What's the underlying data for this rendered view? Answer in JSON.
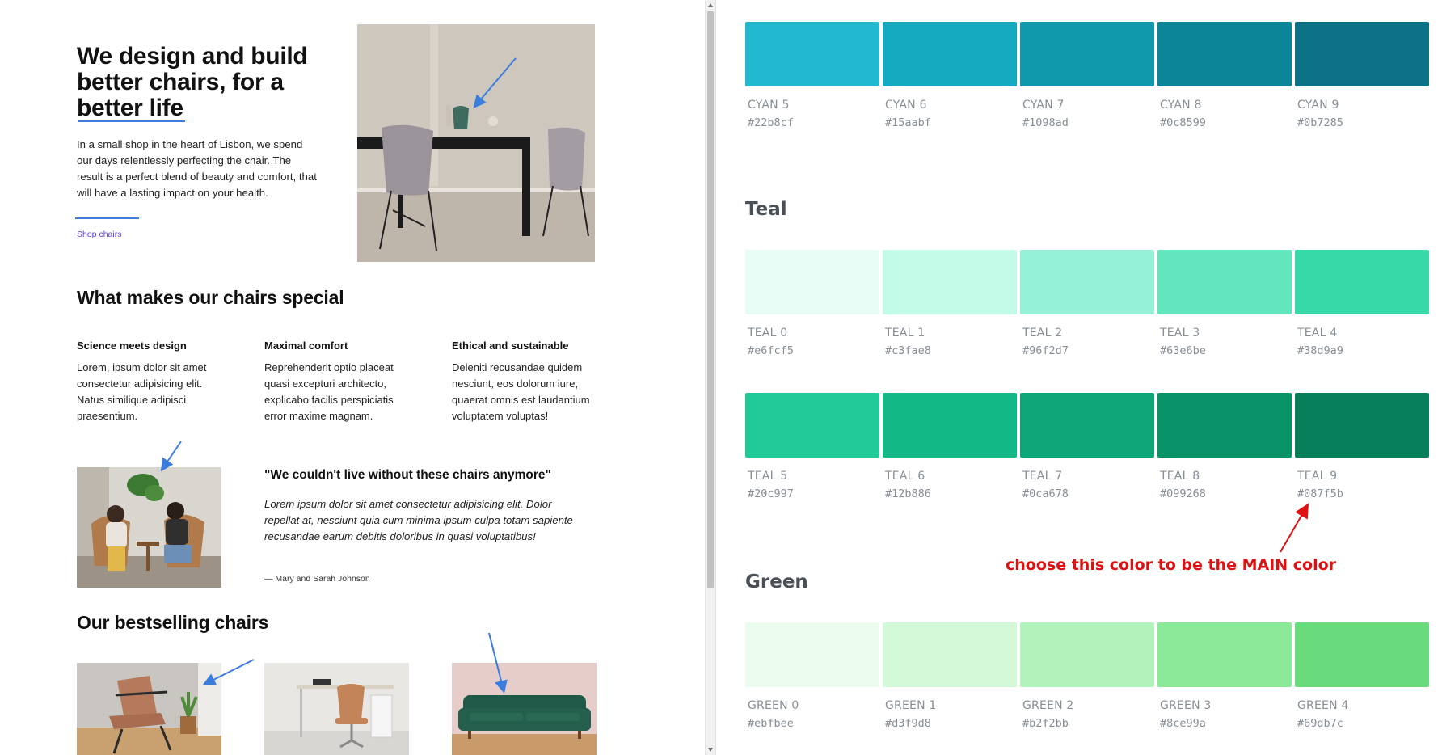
{
  "landing": {
    "hero": {
      "title": "We design and build better chairs, for a better life",
      "description": "In a small shop in the heart of Lisbon, we spend our days relentlessly perfecting the chair. The result is a perfect blend of beauty and comfort, that will have a lasting impact on your health.",
      "link": "Shop chairs"
    },
    "features": {
      "title": "What makes our chairs special",
      "items": [
        {
          "title": "Science meets design",
          "text": "Lorem, ipsum dolor sit amet consectetur adipisicing elit. Natus similique adipisci praesentium."
        },
        {
          "title": "Maximal comfort",
          "text": "Reprehenderit optio placeat quasi excepturi architecto, explicabo facilis perspiciatis error maxime magnam."
        },
        {
          "title": "Ethical and sustainable",
          "text": "Deleniti recusandae quidem nesciunt, eos dolorum iure, quaerat omnis est laudantium voluptatem voluptas!"
        }
      ]
    },
    "testimonial": {
      "title": "\"We couldn't live without these chairs anymore\"",
      "text": "Lorem ipsum dolor sit amet consectetur adipisicing elit. Dolor repellat at, nesciunt quia cum minima ipsum culpa totam sapiente recusandae earum debitis doloribus in quasi voluptatibus!",
      "author": "— Mary and Sarah Johnson"
    },
    "bestsellers": {
      "title": "Our bestselling chairs"
    }
  },
  "palette": {
    "groups": [
      {
        "title": "",
        "swatches": [
          {
            "name": "CYAN 5",
            "hex": "#22b8cf"
          },
          {
            "name": "CYAN 6",
            "hex": "#15aabf"
          },
          {
            "name": "CYAN 7",
            "hex": "#1098ad"
          },
          {
            "name": "CYAN 8",
            "hex": "#0c8599"
          },
          {
            "name": "CYAN 9",
            "hex": "#0b7285"
          }
        ]
      },
      {
        "title": "Teal",
        "swatches": [
          {
            "name": "TEAL 0",
            "hex": "#e6fcf5"
          },
          {
            "name": "TEAL 1",
            "hex": "#c3fae8"
          },
          {
            "name": "TEAL 2",
            "hex": "#96f2d7"
          },
          {
            "name": "TEAL 3",
            "hex": "#63e6be"
          },
          {
            "name": "TEAL 4",
            "hex": "#38d9a9"
          }
        ]
      },
      {
        "title": "",
        "swatches": [
          {
            "name": "TEAL 5",
            "hex": "#20c997"
          },
          {
            "name": "TEAL 6",
            "hex": "#12b886"
          },
          {
            "name": "TEAL 7",
            "hex": "#0ca678"
          },
          {
            "name": "TEAL 8",
            "hex": "#099268"
          },
          {
            "name": "TEAL 9",
            "hex": "#087f5b"
          }
        ]
      },
      {
        "title": "Green",
        "swatches": [
          {
            "name": "GREEN 0",
            "hex": "#ebfbee"
          },
          {
            "name": "GREEN 1",
            "hex": "#d3f9d8"
          },
          {
            "name": "GREEN 2",
            "hex": "#b2f2bb"
          },
          {
            "name": "GREEN 3",
            "hex": "#8ce99a"
          },
          {
            "name": "GREEN 4",
            "hex": "#69db7c"
          }
        ]
      }
    ],
    "note": "choose this color to be the MAIN color"
  },
  "colors": {
    "annotation_blue": "#3b7ddd",
    "annotation_red": "#dd1111",
    "link": "#5b3ed6"
  }
}
